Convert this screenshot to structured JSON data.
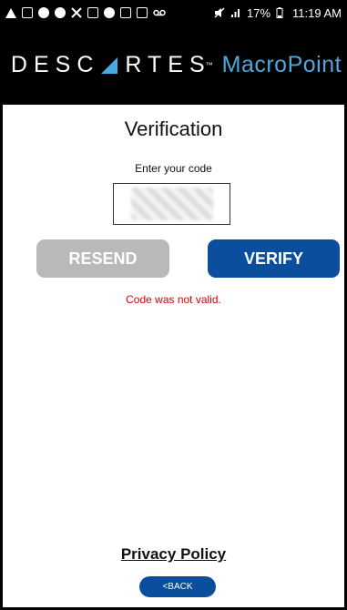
{
  "status_bar": {
    "left_icons": [
      "warning-icon",
      "chat-icon",
      "wifi-icon",
      "fan-icon",
      "cross-icon",
      "image-icon",
      "game-icon",
      "photo-icon",
      "mail-icon",
      "voicemail-icon"
    ],
    "battery_percent": "17%",
    "time": "11:19 AM"
  },
  "brand": {
    "left_text_1": "DESC",
    "left_text_2": "RTES",
    "right_text": "MacroPoint",
    "accent_color": "#4aa8e0"
  },
  "screen": {
    "title": "Verification",
    "prompt": "Enter your code",
    "resend_label": "RESEND",
    "verify_label": "VERIFY",
    "error_message": "Code was not valid.",
    "privacy_label": "Privacy Policy",
    "back_label": "<BACK"
  },
  "colors": {
    "primary": "#0b4e9d",
    "disabled": "#b9b9b9",
    "error": "#e00000"
  }
}
